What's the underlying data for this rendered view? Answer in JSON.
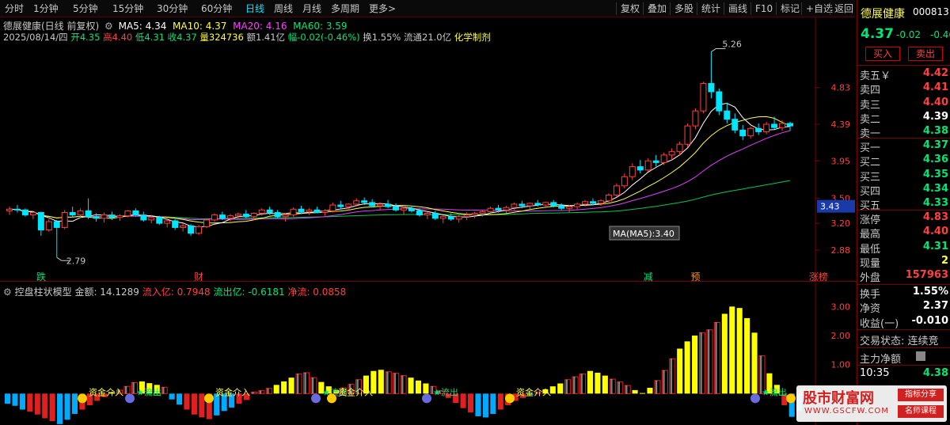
{
  "period_tabs": [
    "分时",
    "1分钟",
    "5分钟",
    "15分钟",
    "30分钟",
    "60分钟",
    "日线",
    "周线",
    "月线",
    "多周期",
    "更多>"
  ],
  "active_tab": "日线",
  "toolbar": [
    "复权",
    "叠加",
    "多股",
    "统计",
    "画线",
    "F10",
    "标记",
    "+自选",
    "返回"
  ],
  "info": {
    "title": "德展健康(日线 前复权)",
    "ma5": "MA5: 4.34",
    "ma10": "MA10: 4.37",
    "ma20": "MA20: 4.16",
    "ma60": "MA60: 3.59",
    "date": "2025/08/14/四",
    "open": "开4.35",
    "high": "高4.40",
    "low": "低4.31",
    "close": "收4.37",
    "volume": "量324736",
    "amount": "额1.41亿",
    "change": "幅-0.02(-0.46%)",
    "turnover": "换1.55%",
    "float": "流通21.0亿",
    "sector": "化学制剂"
  },
  "chart_data": [
    {
      "type": "candlestick",
      "y_ticks": [
        "4.83",
        "4.39",
        "3.95",
        "3.50",
        "3.20",
        "2.88"
      ],
      "ylim": [
        2.65,
        5.35
      ],
      "current_price_tag": "3.43",
      "high_label": "5.26",
      "low_label": "2.79",
      "tooltip": "MA(MA5):3.40",
      "markers": [
        {
          "text": "跌",
          "color": "#00e676",
          "index": 4
        },
        {
          "text": "财",
          "color": "#ff4040",
          "index": 24
        },
        {
          "text": "减",
          "color": "#00e676",
          "index": 81
        },
        {
          "text": "预",
          "color": "#ff9030",
          "index": 87
        },
        {
          "text": "涨榜",
          "color": "#ff4040",
          "index": 102
        }
      ],
      "candles": [
        [
          3.35,
          3.4,
          3.3,
          3.37
        ],
        [
          3.37,
          3.42,
          3.33,
          3.36
        ],
        [
          3.36,
          3.38,
          3.28,
          3.3
        ],
        [
          3.3,
          3.35,
          3.25,
          3.33
        ],
        [
          3.33,
          3.34,
          3.05,
          3.12
        ],
        [
          3.12,
          3.25,
          3.1,
          3.22
        ],
        [
          3.22,
          3.24,
          2.79,
          3.15
        ],
        [
          3.15,
          3.36,
          3.13,
          3.33
        ],
        [
          3.33,
          3.4,
          3.27,
          3.3
        ],
        [
          3.3,
          3.38,
          3.26,
          3.35
        ],
        [
          3.35,
          3.5,
          3.25,
          3.28
        ],
        [
          3.28,
          3.32,
          3.22,
          3.26
        ],
        [
          3.26,
          3.33,
          3.21,
          3.3
        ],
        [
          3.3,
          3.34,
          3.24,
          3.27
        ],
        [
          3.27,
          3.31,
          3.23,
          3.29
        ],
        [
          3.29,
          3.36,
          3.27,
          3.35
        ],
        [
          3.35,
          3.38,
          3.28,
          3.3
        ],
        [
          3.3,
          3.34,
          3.22,
          3.24
        ],
        [
          3.24,
          3.3,
          3.2,
          3.27
        ],
        [
          3.27,
          3.29,
          3.18,
          3.2
        ],
        [
          3.2,
          3.26,
          3.15,
          3.23
        ],
        [
          3.23,
          3.25,
          3.12,
          3.15
        ],
        [
          3.15,
          3.2,
          3.1,
          3.17
        ],
        [
          3.17,
          3.19,
          3.05,
          3.08
        ],
        [
          3.08,
          3.18,
          3.06,
          3.16
        ],
        [
          3.16,
          3.26,
          3.14,
          3.24
        ],
        [
          3.24,
          3.32,
          3.22,
          3.3
        ],
        [
          3.3,
          3.34,
          3.24,
          3.26
        ],
        [
          3.26,
          3.31,
          3.22,
          3.29
        ],
        [
          3.29,
          3.33,
          3.25,
          3.31
        ],
        [
          3.31,
          3.36,
          3.26,
          3.28
        ],
        [
          3.28,
          3.33,
          3.24,
          3.32
        ],
        [
          3.32,
          3.38,
          3.29,
          3.36
        ],
        [
          3.36,
          3.4,
          3.3,
          3.33
        ],
        [
          3.33,
          3.36,
          3.26,
          3.28
        ],
        [
          3.28,
          3.32,
          3.22,
          3.3
        ],
        [
          3.3,
          3.39,
          3.28,
          3.37
        ],
        [
          3.37,
          3.41,
          3.31,
          3.34
        ],
        [
          3.34,
          3.38,
          3.3,
          3.36
        ],
        [
          3.36,
          3.4,
          3.32,
          3.33
        ],
        [
          3.33,
          3.37,
          3.29,
          3.35
        ],
        [
          3.35,
          3.45,
          3.33,
          3.42
        ],
        [
          3.42,
          3.47,
          3.37,
          3.4
        ],
        [
          3.4,
          3.44,
          3.35,
          3.43
        ],
        [
          3.43,
          3.5,
          3.4,
          3.47
        ],
        [
          3.47,
          3.51,
          3.42,
          3.45
        ],
        [
          3.45,
          3.49,
          3.39,
          3.41
        ],
        [
          3.41,
          3.45,
          3.36,
          3.43
        ],
        [
          3.43,
          3.48,
          3.38,
          3.4
        ],
        [
          3.4,
          3.44,
          3.34,
          3.36
        ],
        [
          3.36,
          3.4,
          3.3,
          3.38
        ],
        [
          3.38,
          3.41,
          3.33,
          3.35
        ],
        [
          3.35,
          3.38,
          3.28,
          3.3
        ],
        [
          3.3,
          3.34,
          3.25,
          3.32
        ],
        [
          3.32,
          3.35,
          3.24,
          3.26
        ],
        [
          3.26,
          3.3,
          3.2,
          3.28
        ],
        [
          3.28,
          3.32,
          3.23,
          3.25
        ],
        [
          3.25,
          3.3,
          3.21,
          3.28
        ],
        [
          3.28,
          3.33,
          3.24,
          3.3
        ],
        [
          3.3,
          3.34,
          3.26,
          3.32
        ],
        [
          3.32,
          3.36,
          3.28,
          3.34
        ],
        [
          3.34,
          3.4,
          3.31,
          3.38
        ],
        [
          3.38,
          3.42,
          3.33,
          3.36
        ],
        [
          3.36,
          3.41,
          3.32,
          3.39
        ],
        [
          3.39,
          3.45,
          3.36,
          3.43
        ],
        [
          3.43,
          3.47,
          3.38,
          3.41
        ],
        [
          3.41,
          3.45,
          3.37,
          3.44
        ],
        [
          3.44,
          3.48,
          3.4,
          3.42
        ],
        [
          3.42,
          3.46,
          3.38,
          3.45
        ],
        [
          3.45,
          3.48,
          3.39,
          3.41
        ],
        [
          3.41,
          3.44,
          3.36,
          3.38
        ],
        [
          3.38,
          3.42,
          3.33,
          3.4
        ],
        [
          3.4,
          3.45,
          3.36,
          3.43
        ],
        [
          3.43,
          3.48,
          3.4,
          3.46
        ],
        [
          3.46,
          3.5,
          3.42,
          3.44
        ],
        [
          3.44,
          3.49,
          3.41,
          3.47
        ],
        [
          3.47,
          3.56,
          3.45,
          3.54
        ],
        [
          3.54,
          3.68,
          3.52,
          3.65
        ],
        [
          3.65,
          3.8,
          3.62,
          3.76
        ],
        [
          3.76,
          3.92,
          3.72,
          3.88
        ],
        [
          3.88,
          3.96,
          3.8,
          3.84
        ],
        [
          3.84,
          3.98,
          3.82,
          3.95
        ],
        [
          3.95,
          4.02,
          3.88,
          3.93
        ],
        [
          3.93,
          4.05,
          3.9,
          4.02
        ],
        [
          4.02,
          4.1,
          3.96,
          4.06
        ],
        [
          4.06,
          4.18,
          4.02,
          4.15
        ],
        [
          4.15,
          4.4,
          4.12,
          4.37
        ],
        [
          4.37,
          4.58,
          4.33,
          4.55
        ],
        [
          4.55,
          4.9,
          4.52,
          4.88
        ],
        [
          4.88,
          5.26,
          4.7,
          4.78
        ],
        [
          4.78,
          4.82,
          4.5,
          4.55
        ],
        [
          4.55,
          4.65,
          4.4,
          4.45
        ],
        [
          4.45,
          4.52,
          4.28,
          4.32
        ],
        [
          4.32,
          4.38,
          4.2,
          4.25
        ],
        [
          4.25,
          4.36,
          4.22,
          4.34
        ],
        [
          4.34,
          4.4,
          4.26,
          4.3
        ],
        [
          4.3,
          4.42,
          4.27,
          4.39
        ],
        [
          4.39,
          4.48,
          4.33,
          4.35
        ],
        [
          4.35,
          4.44,
          4.31,
          4.4
        ],
        [
          4.4,
          4.42,
          4.31,
          4.37
        ]
      ],
      "x_offset_candles": 0
    },
    {
      "type": "bar",
      "title": "控盘柱状模型",
      "amount_label": "金额: 14.1289",
      "inflow_label": "流入亿: 0.7948",
      "outflow_label": "流出亿: -0.6181",
      "net_label": "净流: 0.0858",
      "y_ticks": [
        "3.00",
        "2.00",
        "1.00",
        "0.00"
      ],
      "ylim": [
        -1.0,
        3.2
      ],
      "legend_texts": [
        "资金介入",
        "流出",
        "资金介入",
        "流出",
        "资金介入",
        "流出",
        "资金介入",
        "流出",
        "资金介入",
        "流出",
        "资金介"
      ],
      "values": [
        -0.35,
        -0.42,
        -0.55,
        -0.62,
        -0.72,
        -0.85,
        -0.95,
        -1.05,
        -0.9,
        -0.7,
        -0.55,
        -0.4,
        -0.25,
        -0.12,
        0.05,
        0.12,
        0.25,
        0.38,
        0.42,
        0.36,
        0.3,
        0.22,
        -0.2,
        -0.38,
        -0.55,
        -0.72,
        -0.82,
        -0.88,
        -0.75,
        -0.6,
        -0.48,
        -0.35,
        -0.22,
        0.05,
        0.1,
        0.18,
        0.3,
        0.42,
        0.55,
        0.68,
        0.72,
        0.55,
        0.4,
        0.25,
        0.12,
        0.2,
        0.32,
        0.48,
        0.62,
        0.78,
        0.82,
        0.75,
        0.7,
        0.62,
        0.55,
        0.45,
        0.35,
        0.25,
        0.1,
        -0.15,
        -0.32,
        -0.5,
        -0.65,
        -0.78,
        -0.82,
        -0.7,
        -0.55,
        -0.4,
        -0.25,
        -0.15,
        -0.05,
        0.05,
        0.15,
        0.25,
        0.35,
        0.48,
        0.58,
        0.68,
        0.78,
        0.72,
        0.62,
        0.5,
        0.4,
        0.28,
        0.12,
        0.02,
        0.2,
        0.45,
        0.8,
        1.2,
        1.55,
        1.8,
        2.0,
        2.1,
        2.2,
        2.45,
        2.75,
        3.0,
        2.95,
        2.6,
        2.1,
        1.3,
        0.7,
        0.3,
        -0.4,
        -0.8,
        -0.6,
        -0.25
      ],
      "colors": [
        "#e02020",
        "#ffff00",
        "#00aaff"
      ]
    }
  ],
  "quote": {
    "name": "德展健康",
    "code": "000813",
    "price": "4.37",
    "change": "-0.02",
    "pct": "-0.46",
    "buy_label": "买入",
    "sell_label": "卖出",
    "asks": [
      {
        "label": "卖五￥",
        "value": "4.42",
        "color": "#ff4040"
      },
      {
        "label": "卖四",
        "value": "4.41",
        "color": "#ff4040"
      },
      {
        "label": "卖三",
        "value": "4.40",
        "color": "#ff4040"
      },
      {
        "label": "卖二",
        "value": "4.39",
        "color": "#ffffff"
      },
      {
        "label": "卖一",
        "value": "4.38",
        "color": "#00e676"
      }
    ],
    "bids": [
      {
        "label": "买一",
        "value": "4.37",
        "color": "#00e676"
      },
      {
        "label": "买二",
        "value": "4.36",
        "color": "#00e676"
      },
      {
        "label": "买三",
        "value": "4.35",
        "color": "#00e676"
      },
      {
        "label": "买四",
        "value": "4.34",
        "color": "#00e676"
      },
      {
        "label": "买五",
        "value": "4.33",
        "color": "#00e676"
      }
    ],
    "stats": [
      {
        "label": "涨停",
        "value": "4.83",
        "color": "#ff4040"
      },
      {
        "label": "最高",
        "value": "4.40",
        "color": "#ff4040"
      },
      {
        "label": "最低",
        "value": "4.31",
        "color": "#00e676"
      },
      {
        "label": "现量",
        "value": "2",
        "color": "#ffff40"
      },
      {
        "label": "外盘",
        "value": "157963",
        "color": "#ff4040"
      }
    ],
    "stats2": [
      {
        "label": "换手",
        "value": "1.55%",
        "color": "#ffffff"
      },
      {
        "label": "净资",
        "value": "2.37",
        "color": "#ffffff"
      },
      {
        "label": "收益(一)",
        "value": "-0.010",
        "color": "#ffffff"
      }
    ],
    "trade_status": "交易状态: 连续竞",
    "main_net": "主力净额",
    "time": "10:35",
    "time_value": "4.38"
  },
  "watermark": {
    "title": "股市财富网",
    "url": "WWW.GSCFW.COM",
    "badge1": "指标分享",
    "badge2": "名师课程"
  }
}
